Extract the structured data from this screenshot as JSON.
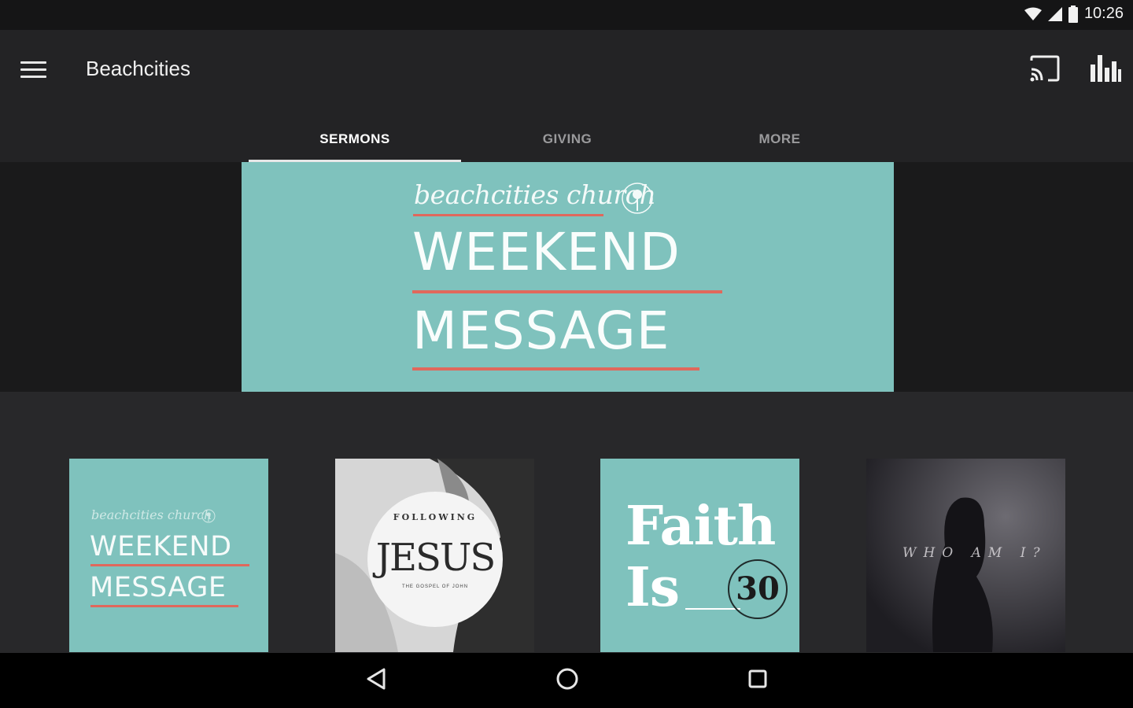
{
  "status_bar": {
    "time": "10:26"
  },
  "app_bar": {
    "title": "Beachcities"
  },
  "tabs": [
    {
      "label": "SERMONS",
      "active": true
    },
    {
      "label": "GIVING",
      "active": false
    },
    {
      "label": "MORE",
      "active": false
    }
  ],
  "hero": {
    "script_text": "beachcities church",
    "line1": "WEEKEND",
    "line2": "MESSAGE"
  },
  "series_cards": [
    {
      "script_text": "beachcities church",
      "line1": "WEEKEND",
      "line2": "MESSAGE"
    },
    {
      "top_text": "FOLLOWING",
      "main_text": "JESUS",
      "sub_text": "THE GOSPEL OF JOHN"
    },
    {
      "line1": "Faith",
      "line2": "Is",
      "badge": "30"
    },
    {
      "text": "WHO AM I?"
    }
  ],
  "colors": {
    "accent_teal": "#7fc2bd",
    "accent_red": "#e0685c",
    "app_bar": "#232325",
    "background": "#28282a"
  },
  "icons": {
    "menu": "hamburger-menu-icon",
    "cast": "cast-icon",
    "stats": "bar-chart-icon",
    "back": "back-triangle-icon",
    "home": "home-circle-icon",
    "recent": "recent-square-icon"
  }
}
